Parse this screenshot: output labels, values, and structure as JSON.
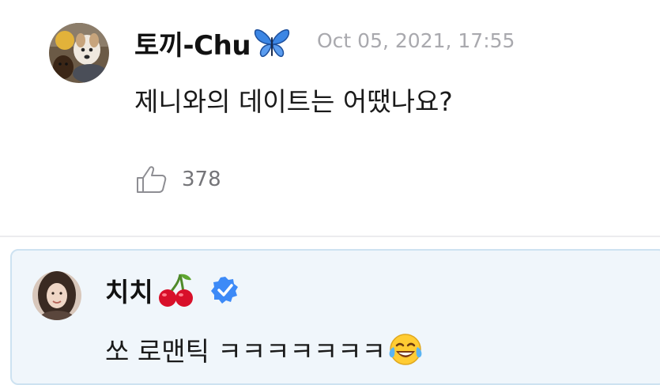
{
  "question": {
    "author_name": "토끼-Chu",
    "author_emoji": "butterfly-icon",
    "timestamp": "Oct 05, 2021, 17:55",
    "text": "제니와의 데이트는 어땠나요?",
    "like_count": "378"
  },
  "reply": {
    "author_name": "치치",
    "author_emoji": "cherries-icon",
    "verified": true,
    "text": "쏘 로맨틱 ㅋㅋㅋㅋㅋㅋㅋ",
    "text_emoji": "tears-of-joy-icon"
  },
  "colors": {
    "reply_card_bg": "#f0f6fb",
    "reply_card_border": "#cde2f1",
    "verified_badge": "#3d8af7",
    "timestamp": "#a9a9ae"
  }
}
